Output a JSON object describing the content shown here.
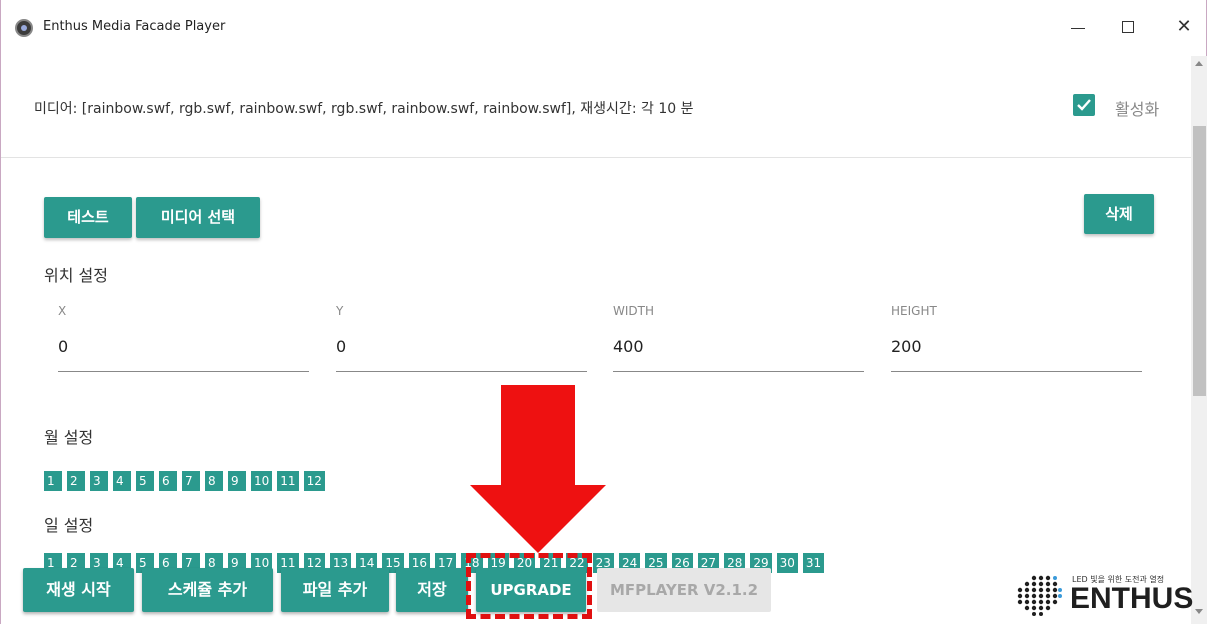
{
  "window": {
    "title": "Enthus Media Facade Player",
    "controls": {
      "minimize": "—",
      "maximize": "☐",
      "close": "✕"
    }
  },
  "media": {
    "text": "미디어: [rainbow.swf, rgb.swf, rainbow.swf, rgb.swf, rainbow.swf, rainbow.swf], 재생시간: 각 10 분",
    "enabled_label": "활성화",
    "enabled": true
  },
  "actions": {
    "test": "테스트",
    "select_media": "미디어 선택",
    "delete": "삭제"
  },
  "position": {
    "heading": "위치 설정",
    "fields": [
      {
        "label": "X",
        "value": "0"
      },
      {
        "label": "Y",
        "value": "0"
      },
      {
        "label": "WIDTH",
        "value": "400"
      },
      {
        "label": "HEIGHT",
        "value": "200"
      }
    ]
  },
  "month": {
    "heading": "월 설정",
    "values": [
      "1",
      "2",
      "3",
      "4",
      "5",
      "6",
      "7",
      "8",
      "9",
      "10",
      "11",
      "12"
    ]
  },
  "day": {
    "heading": "일 설정",
    "values": [
      "1",
      "2",
      "3",
      "4",
      "5",
      "6",
      "7",
      "8",
      "9",
      "10",
      "11",
      "12",
      "13",
      "14",
      "15",
      "16",
      "17",
      "18",
      "19",
      "20",
      "21",
      "22",
      "23",
      "24",
      "25",
      "26",
      "27",
      "28",
      "29",
      "30",
      "31"
    ]
  },
  "bottom": {
    "play": "재생 시작",
    "add_schedule": "스케쥴 추가",
    "add_file": "파일 추가",
    "save": "저장",
    "upgrade": "UPGRADE",
    "version": "MFPLAYER V2.1.2"
  },
  "logo": {
    "tagline": "LED 빛을 위한 도전과 열정",
    "word": "ENTHUS"
  },
  "colors": {
    "accent": "#2b9a8e",
    "annotation": "#e01010"
  }
}
